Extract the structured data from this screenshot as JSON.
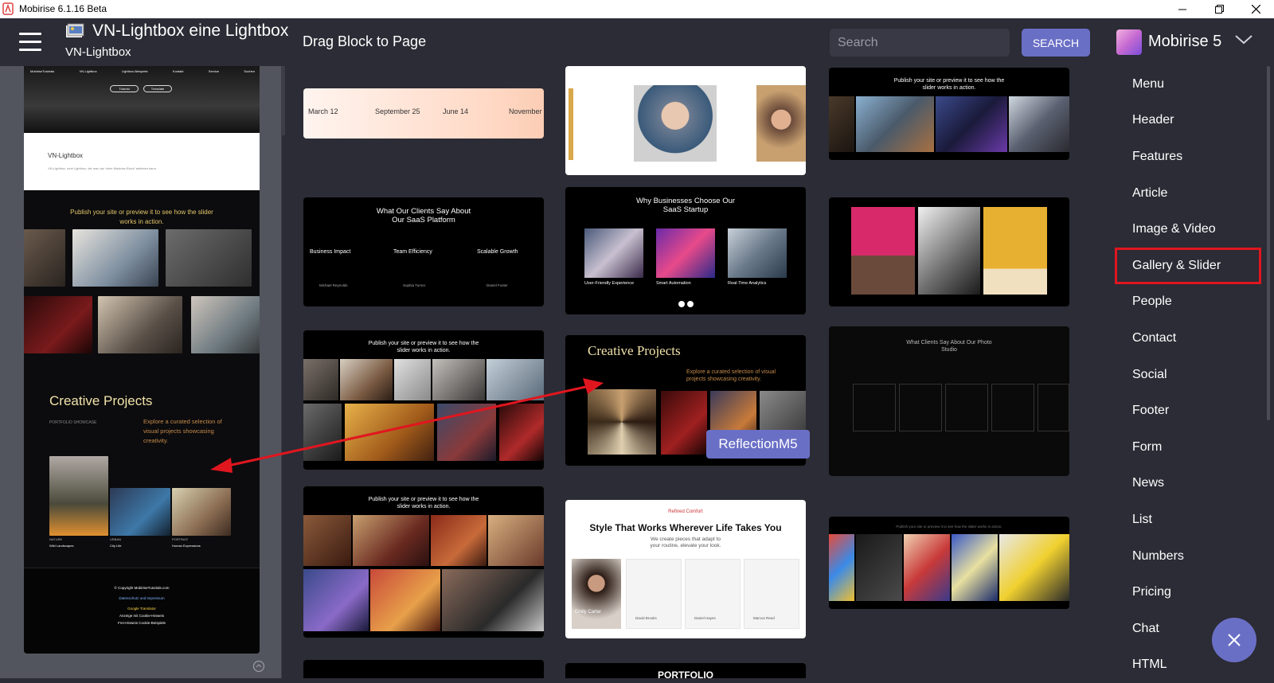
{
  "window": {
    "title": "Mobirise 6.1.16 Beta",
    "minimize": "—",
    "maximize": "❐",
    "close": "✕"
  },
  "header": {
    "page_title": "VN-Lightbox eine Lightbox fü",
    "page_subtitle": "VN-Lightbox",
    "drag_title": "Drag Block to Page",
    "search_placeholder": "Search",
    "search_button": "SEARCH"
  },
  "brand": {
    "name": "Mobirise 5",
    "logo_text": "Mobirise"
  },
  "categories": [
    {
      "label": "Menu",
      "active": false
    },
    {
      "label": "Header",
      "active": false
    },
    {
      "label": "Features",
      "active": false
    },
    {
      "label": "Article",
      "active": false
    },
    {
      "label": "Image & Video",
      "active": false
    },
    {
      "label": "Gallery & Slider",
      "active": true
    },
    {
      "label": "People",
      "active": false
    },
    {
      "label": "Contact",
      "active": false
    },
    {
      "label": "Social",
      "active": false
    },
    {
      "label": "Footer",
      "active": false
    },
    {
      "label": "Form",
      "active": false
    },
    {
      "label": "News",
      "active": false
    },
    {
      "label": "List",
      "active": false
    },
    {
      "label": "Numbers",
      "active": false
    },
    {
      "label": "Pricing",
      "active": false
    },
    {
      "label": "Chat",
      "active": false
    },
    {
      "label": "HTML",
      "active": false
    }
  ],
  "preview": {
    "nav_brand": "MobiriseTutorials",
    "nav_items": [
      "VN-Lightbox",
      "Lightbox-Beispiele",
      "Kontakt",
      "Service",
      "Suchen"
    ],
    "hero_buttons": [
      "Tutorial",
      "Translate"
    ],
    "intro_title": "VN-Lightbox",
    "intro_text": "VN-Lightbox, eine Lightbox, die man als 'ohne Mobirise-Block' anbieten kann.",
    "slider_heading": "Publish your site or preview it to see how the slider works in action.",
    "creative_title": "Creative Projects",
    "creative_category": "PORTFOLIO SHOWCASE",
    "creative_desc": "Explore a curated selection of visual projects showcasing creativity.",
    "captions": [
      {
        "tag": "NATURE",
        "title": "Wild Landscapes"
      },
      {
        "tag": "URBAN",
        "title": "City Life"
      },
      {
        "tag": "PORTRAIT",
        "title": "Human Expressions"
      }
    ],
    "footer": {
      "copyright": "© Copyright MobiriseTutorials.com",
      "links": "Datenschutz und Impressum",
      "translator": "Google Translator",
      "l1": "Anzeige mit Cookie-Hinweis",
      "l2": "Frei-Hinweis Cookie-Beispiele"
    }
  },
  "thumbnails": {
    "timeline": {
      "dates": [
        "March 12",
        "September 25",
        "June 14",
        "November"
      ]
    },
    "clients": {
      "title": "What Our Clients Say About Our SaaS Platform",
      "cols": [
        "Business Impact",
        "Team Efficiency",
        "Scalable Growth"
      ],
      "names": [
        "Michael Reynolds",
        "Sophia Turner",
        "Daniel Foster"
      ]
    },
    "why": {
      "title": "Why Businesses Choose Our SaaS Startup",
      "features": [
        "User-Friendly Experience",
        "Smart Automation",
        "Real-Time Analytics"
      ]
    },
    "publish1": {
      "title": "Publish your site or preview it to see how the slider works in action."
    },
    "creative": {
      "title": "Creative Projects",
      "desc": "Explore a curated selection of visual projects showcasing creativity.",
      "label": "ReflectionM5"
    },
    "clients_photo": {
      "title": "What Clients Say About Our Photo Studio"
    },
    "publish2": {
      "title": "Publish your site or preview it to see how the slider works in action."
    },
    "style": {
      "tag": "Refined Comfort",
      "title": "Style That Works Wherever Life Takes You",
      "subtitle": "We create pieces that adapt to your routine, elevate your look.",
      "person": "Emily Carter",
      "names": [
        "David Brooks",
        "Daniel Hayes",
        "Marcus Reed"
      ]
    },
    "publish3": {
      "title": "Publish your site or preview it to see how the slider works in action."
    },
    "portfolio": {
      "title": "PORTFOLIO"
    }
  }
}
